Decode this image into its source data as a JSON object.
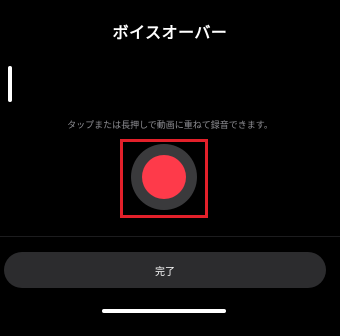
{
  "header": {
    "title": "ボイスオーバー"
  },
  "recording": {
    "hint": "タップまたは長押しで動画に重ねて録音できます。",
    "record_icon": "record-icon",
    "highlighted": true
  },
  "footer": {
    "done_label": "完了"
  },
  "colors": {
    "background": "#000000",
    "record_red": "#fe3a4a",
    "highlight_red": "#e3202a",
    "button_bg": "#2c2c2e"
  }
}
